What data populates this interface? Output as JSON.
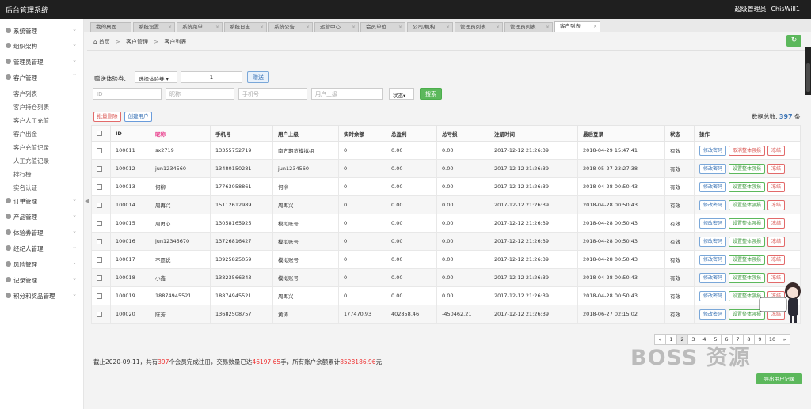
{
  "app": {
    "title": "后台管理系统",
    "role": "超级管理员",
    "username": "ChisWill1"
  },
  "sidebar": {
    "items": [
      {
        "label": "系统管理"
      },
      {
        "label": "组织架构"
      },
      {
        "label": "管理员管理"
      },
      {
        "label": "客户管理"
      },
      {
        "label": "订单管理"
      },
      {
        "label": "产品管理"
      },
      {
        "label": "体验券管理"
      },
      {
        "label": "经纪人管理"
      },
      {
        "label": "风险管理"
      },
      {
        "label": "记录管理"
      },
      {
        "label": "积分和奖品管理"
      }
    ],
    "sub": [
      "客户列表",
      "客户持仓列表",
      "客户人工充值",
      "客户出金",
      "客户充值记录",
      "人工充值记录",
      "排行榜",
      "实名认证"
    ]
  },
  "tabs": [
    "我的桌面",
    "系统设置",
    "系统菜单",
    "系统日志",
    "系统公告",
    "运营中心",
    "会员单位",
    "公司/机构",
    "管理员列表",
    "管理员列表",
    "客户列表"
  ],
  "breadcrumb": {
    "home": "首页",
    "sep": ">",
    "level1": "客户管理",
    "level2": "客户列表"
  },
  "gift": {
    "label": "赠送体验券:",
    "select": "选择体验券",
    "qty": "1",
    "send": "赠送"
  },
  "filters": {
    "id": "ID",
    "nickname": "昵称",
    "phone": "手机号",
    "parent": "用户上级",
    "status": "状态",
    "search": "搜索"
  },
  "actions": {
    "batch_delete": "批量删除",
    "create_user": "创建用户"
  },
  "total": {
    "label": "数据总数:",
    "value": "397",
    "unit": "条"
  },
  "table": {
    "headers": [
      "ID",
      "昵称",
      "手机号",
      "用户上级",
      "实时余额",
      "总盈利",
      "总亏损",
      "注册时间",
      "最后登录",
      "状态",
      "操作"
    ],
    "rows": [
      {
        "id": "100011",
        "nick": "sx2719",
        "phone": "13355752719",
        "parent": "南方期货模拟组",
        "balance": "0",
        "profit": "0.00",
        "loss": "0.00",
        "reg": "2017-12-12 21:26:39",
        "login": "2018-04-29 15:47:41",
        "status": "有效",
        "b1": "修改密码",
        "b2": "取消整体强损",
        "b3": "冻结"
      },
      {
        "id": "100012",
        "nick": "jun1234560",
        "phone": "13480150281",
        "parent": "jun1234560",
        "balance": "0",
        "profit": "0.00",
        "loss": "0.00",
        "reg": "2017-12-12 21:26:39",
        "login": "2018-05-27 23:27:38",
        "status": "有效",
        "b1": "修改密码",
        "b2": "设置整体强损",
        "b3": "冻结"
      },
      {
        "id": "100013",
        "nick": "何柳",
        "phone": "17763058861",
        "parent": "何柳",
        "balance": "0",
        "profit": "0.00",
        "loss": "0.00",
        "reg": "2017-12-12 21:26:39",
        "login": "2018-04-28 00:50:43",
        "status": "有效",
        "b1": "修改密码",
        "b2": "设置整体强损",
        "b3": "冻结"
      },
      {
        "id": "100014",
        "nick": "周再兴",
        "phone": "15112612989",
        "parent": "周再兴",
        "balance": "0",
        "profit": "0.00",
        "loss": "0.00",
        "reg": "2017-12-12 21:26:39",
        "login": "2018-04-28 00:50:43",
        "status": "有效",
        "b1": "修改密码",
        "b2": "设置整体强损",
        "b3": "冻结"
      },
      {
        "id": "100015",
        "nick": "周再心",
        "phone": "13058165925",
        "parent": "模拟账号",
        "balance": "0",
        "profit": "0.00",
        "loss": "0.00",
        "reg": "2017-12-12 21:26:39",
        "login": "2018-04-28 00:50:43",
        "status": "有效",
        "b1": "修改密码",
        "b2": "设置整体强损",
        "b3": "冻结"
      },
      {
        "id": "100016",
        "nick": "jun12345670",
        "phone": "13726816427",
        "parent": "模拟账号",
        "balance": "0",
        "profit": "0.00",
        "loss": "0.00",
        "reg": "2017-12-12 21:26:39",
        "login": "2018-04-28 00:50:43",
        "status": "有效",
        "b1": "修改密码",
        "b2": "设置整体强损",
        "b3": "冻结"
      },
      {
        "id": "100017",
        "nick": "不愿说",
        "phone": "13925825059",
        "parent": "模拟账号",
        "balance": "0",
        "profit": "0.00",
        "loss": "0.00",
        "reg": "2017-12-12 21:26:39",
        "login": "2018-04-28 00:50:43",
        "status": "有效",
        "b1": "修改密码",
        "b2": "设置整体强损",
        "b3": "冻结"
      },
      {
        "id": "100018",
        "nick": "小鑫",
        "phone": "13823566343",
        "parent": "模拟账号",
        "balance": "0",
        "profit": "0.00",
        "loss": "0.00",
        "reg": "2017-12-12 21:26:39",
        "login": "2018-04-28 00:50:43",
        "status": "有效",
        "b1": "修改密码",
        "b2": "设置整体强损",
        "b3": "冻结"
      },
      {
        "id": "100019",
        "nick": "18874945521",
        "phone": "18874945521",
        "parent": "周再兴",
        "balance": "0",
        "profit": "0.00",
        "loss": "0.00",
        "reg": "2017-12-12 21:26:39",
        "login": "2018-04-28 00:50:43",
        "status": "有效",
        "b1": "修改密码",
        "b2": "设置整体强损",
        "b3": "冻结"
      },
      {
        "id": "100020",
        "nick": "陈芳",
        "phone": "13682508757",
        "parent": "黄涛",
        "balance": "177470.93",
        "profit": "402858.46",
        "loss": "-450462.21",
        "reg": "2017-12-12 21:26:39",
        "login": "2018-06-27 02:15:02",
        "status": "有效",
        "b1": "修改密码",
        "b2": "设置整体强损",
        "b3": "冻结"
      }
    ]
  },
  "pager": [
    "«",
    "1",
    "2",
    "3",
    "4",
    "5",
    "6",
    "7",
    "8",
    "9",
    "10",
    "»"
  ],
  "summary": {
    "p1": "截止2020-09-11，共有",
    "users": "397",
    "p2": "个会员完成注册，交易数量已达",
    "volume": "46197.65",
    "p3": "手，所有账户余额累计",
    "balance": "8528186.96",
    "p4": "元"
  },
  "export": "导出用户记录",
  "watermark": "BOSS 资源"
}
